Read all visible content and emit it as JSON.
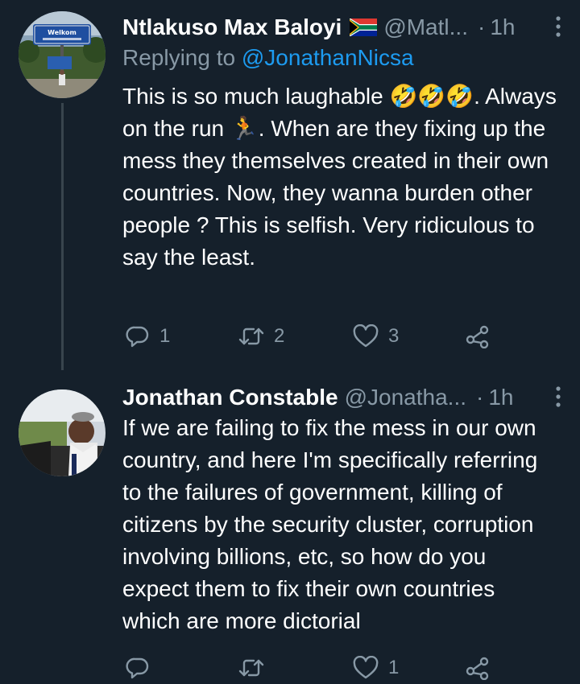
{
  "tweets": [
    {
      "display_name": "Ntlakuso Max Baloyi",
      "flag_icon": "south-africa-flag-icon",
      "handle": "@Matl...",
      "separator": "·",
      "time": "1h",
      "replying_prefix": "Replying to",
      "replying_to": "@JonathanNicsa",
      "text_part1": "This is so much laughable",
      "emoji_1": "🤣🤣🤣",
      "text_part2": ". Always on the run",
      "emoji_2": "🏃",
      "text_part3": ". When are they fixing up the mess they themselves created in their own countries. Now, they wanna burden other people ? This is selfish. Very ridiculous to say the least.",
      "replies": "1",
      "retweets": "2",
      "likes": "3",
      "avatar_sign_text": "Welkom"
    },
    {
      "display_name": "Jonathan Constable",
      "handle": "@Jonatha...",
      "separator": "·",
      "time": "1h",
      "text": "If we are failing to fix the mess in our own country, and here I'm specifically referring to the failures of government, killing of citizens by the security cluster, corruption involving billions, etc, so how do you expect them to fix their own countries which are more dictorial",
      "replies": "",
      "retweets": "",
      "likes": "1"
    }
  ],
  "colors": {
    "background": "#15202b",
    "text_primary": "#ffffff",
    "text_secondary": "#8899a6",
    "link": "#1d9bf0",
    "thread_line": "#38444d"
  }
}
